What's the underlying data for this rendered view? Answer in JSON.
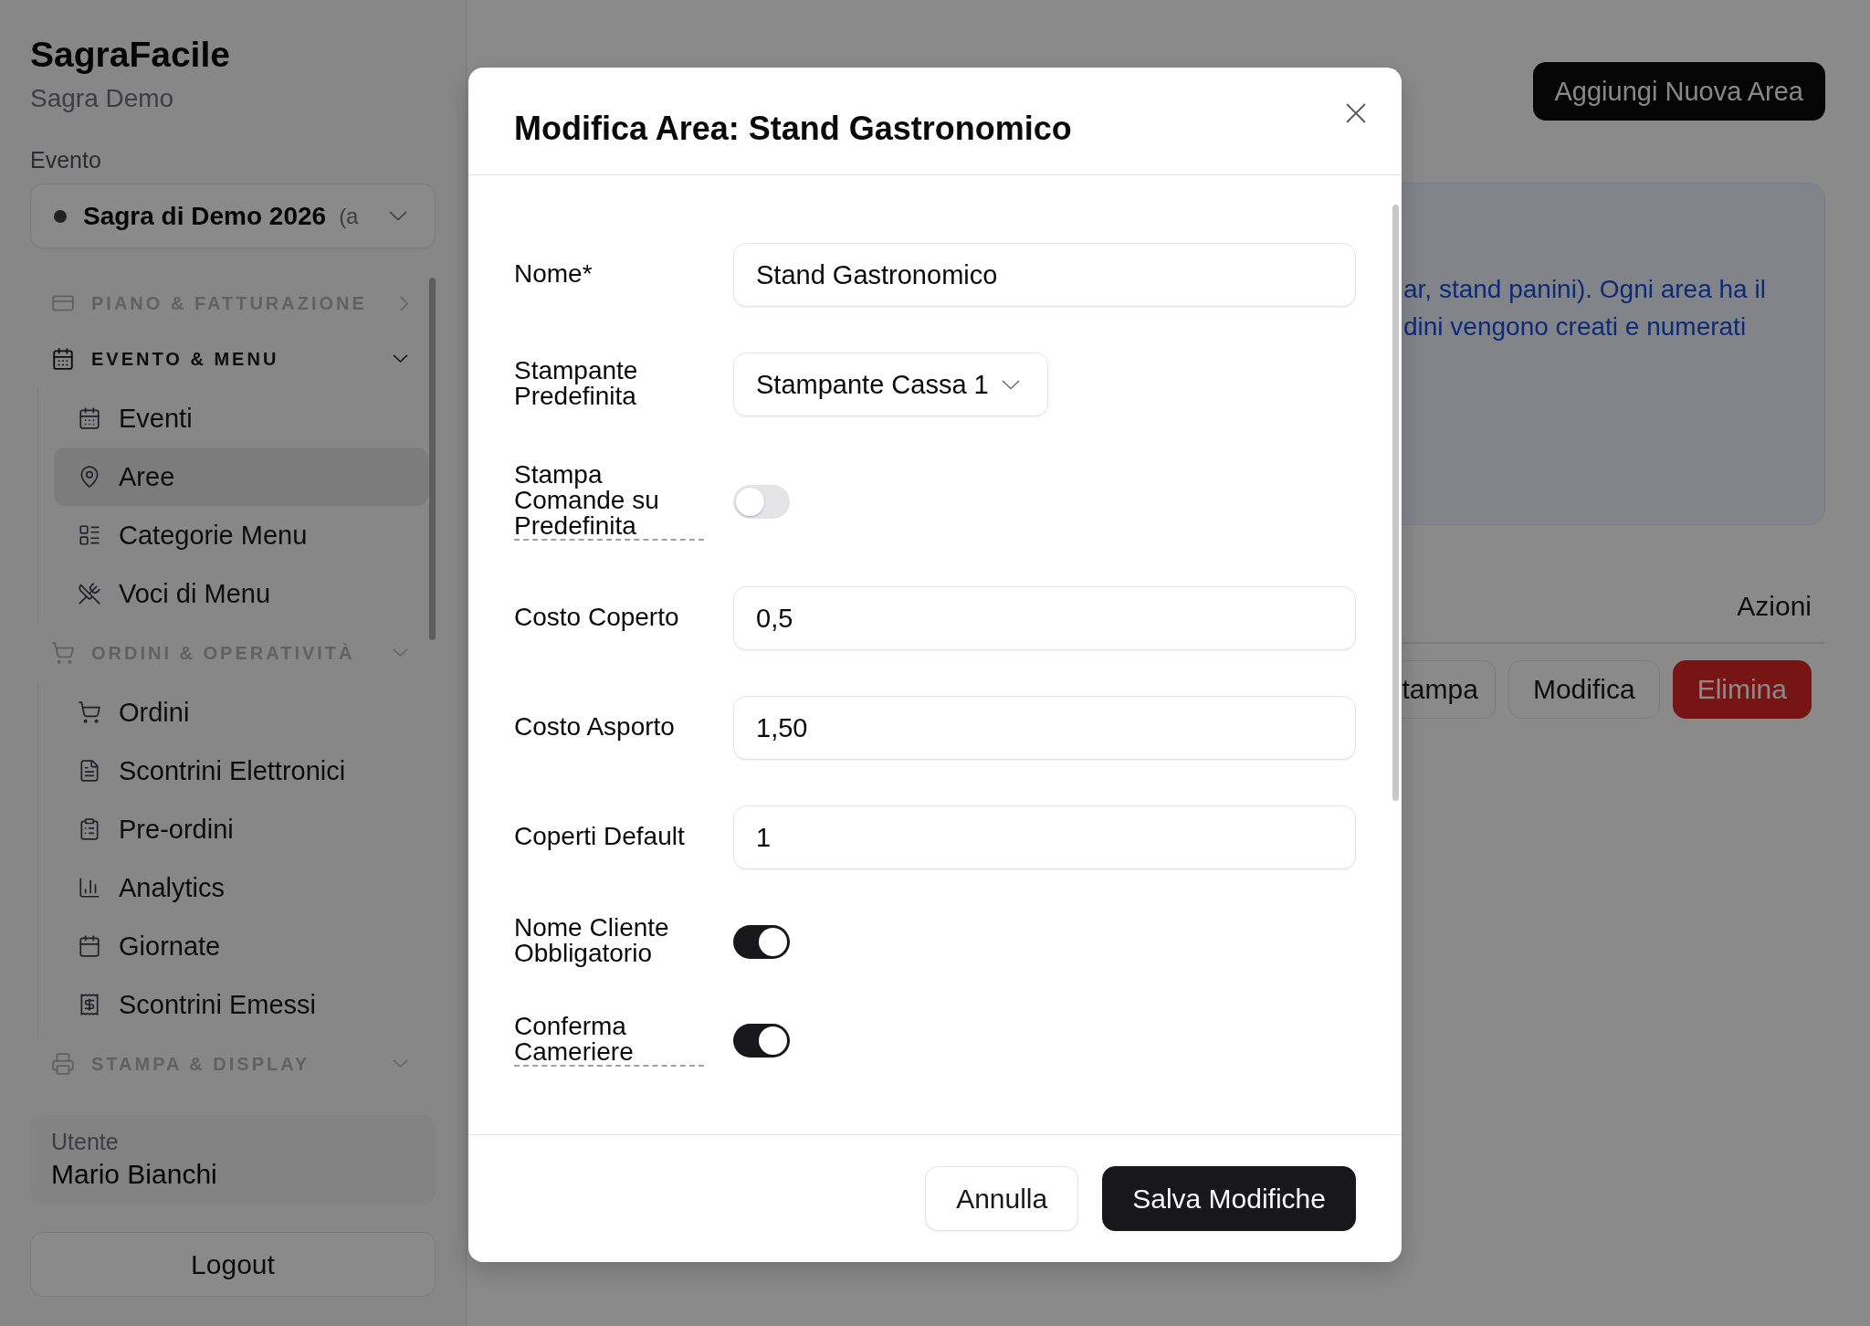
{
  "sidebar": {
    "app_name": "SagraFacile",
    "subtitle": "Sagra Demo",
    "event_label": "Evento",
    "event_select": {
      "name": "Sagra di Demo 2026",
      "note": "(a"
    },
    "groups": [
      {
        "label": "PIANO & FATTURAZIONE",
        "expanded": false
      },
      {
        "label": "EVENTO & MENU",
        "expanded": true,
        "items": [
          {
            "label": "Eventi",
            "selected": false
          },
          {
            "label": "Aree",
            "selected": true
          },
          {
            "label": "Categorie Menu",
            "selected": false
          },
          {
            "label": "Voci di Menu",
            "selected": false
          }
        ]
      },
      {
        "label": "ORDINI & OPERATIVITÀ",
        "expanded": true,
        "items": [
          {
            "label": "Ordini",
            "selected": false
          },
          {
            "label": "Scontrini Elettronici",
            "selected": false
          },
          {
            "label": "Pre-ordini",
            "selected": false
          },
          {
            "label": "Analytics",
            "selected": false
          },
          {
            "label": "Giornate",
            "selected": false
          },
          {
            "label": "Scontrini Emessi",
            "selected": false
          }
        ]
      },
      {
        "label": "STAMPA & DISPLAY",
        "expanded": true
      }
    ],
    "user": {
      "label": "Utente",
      "name": "Mario Bianchi"
    },
    "logout": "Logout"
  },
  "header": {
    "add_button": "Aggiungi Nuova Area"
  },
  "info_box": {
    "lines": [
      "ar, stand panini). Ogni area ha il",
      "dini vengono creati e numerati"
    ]
  },
  "table": {
    "columns": [
      "Azioni"
    ],
    "rows": [
      {
        "actions": [
          {
            "label": "tampa",
            "kind": "outline"
          },
          {
            "label": "Modifica",
            "kind": "outline"
          },
          {
            "label": "Elimina",
            "kind": "danger"
          }
        ]
      }
    ]
  },
  "dialog": {
    "title": "Modifica Area: Stand Gastronomico",
    "fields": [
      {
        "label": "Nome*",
        "kind": "text",
        "value": "Stand Gastronomico",
        "help": false
      },
      {
        "label": "Stampante Predefinita",
        "kind": "select",
        "value": "Stampante Cassa 1",
        "help": false
      },
      {
        "label": "Stampa Comande su Predefinita",
        "kind": "toggle",
        "on": false,
        "help": true
      },
      {
        "label": "Costo Coperto",
        "kind": "text",
        "value": "0,5",
        "help": false
      },
      {
        "label": "Costo Asporto",
        "kind": "text",
        "value": "1,50",
        "help": false
      },
      {
        "label": "Coperti Default",
        "kind": "text",
        "value": "1",
        "help": false
      },
      {
        "label": "Nome Cliente Obbligatorio",
        "kind": "toggle",
        "on": true,
        "help": false
      },
      {
        "label": "Conferma Cameriere",
        "kind": "toggle",
        "on": true,
        "help": true
      }
    ],
    "buttons": [
      {
        "label": "Annulla",
        "kind": "secondary"
      },
      {
        "label": "Salva Modifiche",
        "kind": "primary"
      }
    ]
  }
}
